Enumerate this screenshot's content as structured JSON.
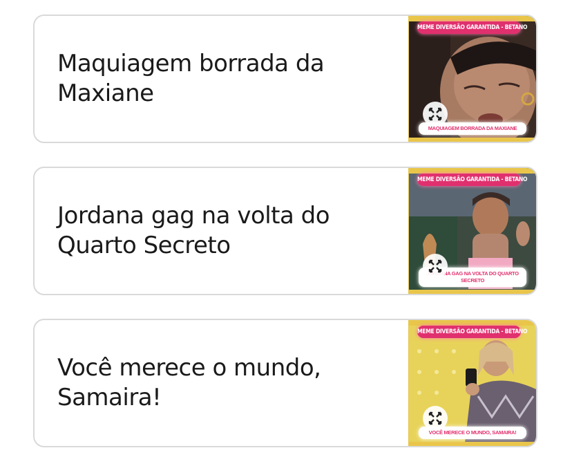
{
  "cards": [
    {
      "title": "Maquiagem borrada da Maxiane",
      "tag": "MEME DIVERSÃO GARANTIDA - BETANO",
      "caption": "MAQUIAGEM BORRADA DA MAXIANE"
    },
    {
      "title": "Jordana gag na volta do Quarto Secreto",
      "tag": "MEME DIVERSÃO GARANTIDA - BETANO",
      "caption": "JORDANA GAG NA VOLTA DO QUARTO SECRETO"
    },
    {
      "title": "Você merece o mundo, Samaira!",
      "tag": "MEME DIVERSÃO GARANTIDA - BETANO",
      "caption": "VOCÊ MERECE O MUNDO, SAMAIRA!"
    }
  ],
  "icons": {
    "expand": "expand-arrows-icon"
  },
  "colors": {
    "tag": "#e0306e",
    "frame": "#e9c64a",
    "border": "#d9d9d9"
  }
}
